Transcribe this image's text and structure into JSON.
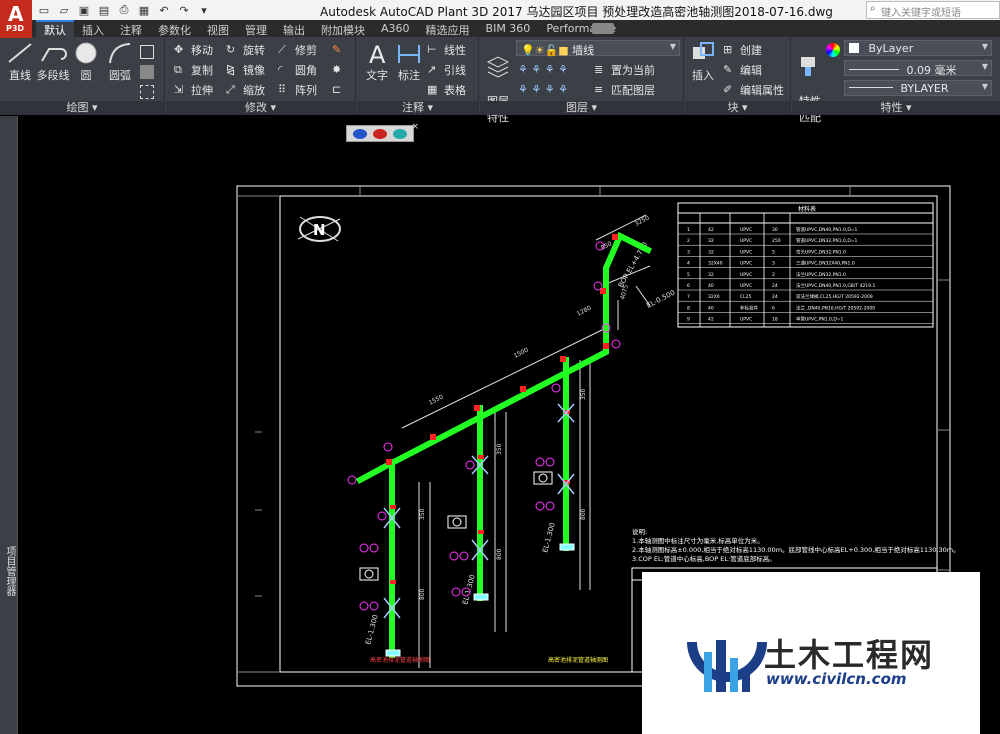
{
  "app": {
    "logo_letter": "A",
    "logo_sub": "P3D",
    "title": "Autodesk AutoCAD Plant 3D 2017    乌达园区项目 预处理改造高密池轴测图2018-07-16.dwg",
    "search_placeholder": "键入关键字或短语"
  },
  "tabs": [
    "默认",
    "插入",
    "注释",
    "参数化",
    "视图",
    "管理",
    "输出",
    "附加模块",
    "A360",
    "精选应用",
    "BIM 360",
    "Performance"
  ],
  "panels": {
    "draw": {
      "title": "绘图 ▾",
      "line": "直线",
      "polyline": "多段线",
      "circle": "圆",
      "arc": "圆弧"
    },
    "modify": {
      "title": "修改 ▾",
      "move": "移动",
      "rotate": "旋转",
      "trim": "修剪",
      "copy": "复制",
      "mirror": "镜像",
      "fillet": "圆角",
      "stretch": "拉伸",
      "scale": "缩放",
      "array": "阵列"
    },
    "annotation": {
      "title": "注释 ▾",
      "text": "文字",
      "dimension": "标注",
      "linear": "线性",
      "leader": "引线",
      "table": "表格"
    },
    "layers": {
      "title": "图层 ▾",
      "layer_props": "图层\n特性",
      "current_layer": "墙线",
      "set_current": "置为当前",
      "match_layer": "匹配图层"
    },
    "block": {
      "title": "块 ▾",
      "insert": "插入",
      "create": "创建",
      "edit": "编辑",
      "edit_attr": "编辑属性"
    },
    "properties": {
      "title": "特性 ▾",
      "match": "特性\n匹配",
      "color": "ByLayer",
      "lineweight": "0.09 毫米",
      "linetype": "BYLAYER"
    }
  },
  "palette": {
    "label": "项目管理器"
  },
  "drawing": {
    "north": "N",
    "dims": [
      "1550",
      "1500",
      "1280",
      "850",
      "350",
      "3250",
      "4075",
      "350",
      "350",
      "350",
      "350",
      "800",
      "800",
      "800"
    ],
    "level_labels": [
      "EL-0.500",
      "EL-1.300",
      "EL-1.300",
      "EL-1.300",
      "BOP EL+4.700"
    ],
    "table_header": "材料表",
    "table_rows": [
      [
        "1",
        "42",
        "UPVC",
        "30",
        "管道UPVC,DN40,PN1.0,D=1"
      ],
      [
        "2",
        "32",
        "UPVC",
        "250",
        "管道UPVC,DN32,PN1.0,D=1"
      ],
      [
        "3",
        "32",
        "UPVC",
        "5",
        "弯头UPVC,DN32,PN1.0"
      ],
      [
        "4",
        "32X40",
        "UPVC",
        "3",
        "三通UPVC,DN32X40,PN1.0"
      ],
      [
        "5",
        "32",
        "UPVC",
        "2",
        "法兰UPVC,DN32,PN1.0"
      ],
      [
        "6",
        "40",
        "UPVC",
        "24",
        "法兰UPVC,DN40,PN1.0,GB/T 4219.1"
      ],
      [
        "7",
        "32X0",
        "CL25",
        "24",
        "双法兰球阀,CL25,HG/T 20592-2009"
      ],
      [
        "8",
        "40",
        "非标准件",
        "6",
        "法兰 ,DN40,PN10,HG/T 20592-2009"
      ],
      [
        "9",
        "42",
        "UPVC",
        "18",
        "单管UPVC,PN1.0,D=1"
      ]
    ],
    "notes": [
      "说明:",
      "1.本轴测图中标注尺寸为毫米,标高单位为米。",
      "2.本轴测图标高±0.000,相当于绝对标高1130.00m。底部管线中心标高EL+0.300,相当于绝对标高1130.30m。",
      "3.COP EL:管道中心标高,BOP EL:管道底部标高。"
    ],
    "caption_left": "高密池排泥管道轴测图",
    "caption_right": "高密池排泥管道轴测图"
  },
  "watermark": {
    "main": "土木工程网",
    "url": "www.civilcn.com"
  },
  "colors": {
    "pipe": "#22ff22",
    "accent": "#2f7fe0",
    "logo": "#c42b1c",
    "marker": "#ff33ff"
  }
}
